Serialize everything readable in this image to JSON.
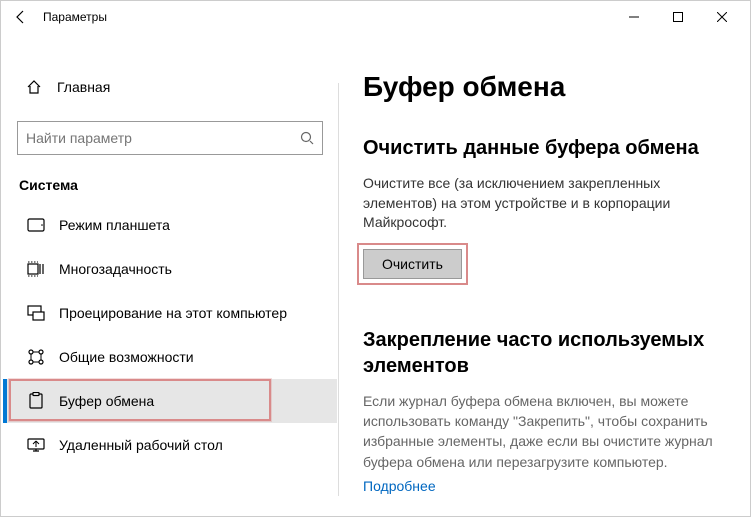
{
  "titlebar": {
    "title": "Параметры"
  },
  "sidebar": {
    "home": "Главная",
    "search_placeholder": "Найти параметр",
    "category": "Система",
    "items": [
      {
        "label": "Режим планшета"
      },
      {
        "label": "Многозадачность"
      },
      {
        "label": "Проецирование на этот компьютер"
      },
      {
        "label": "Общие возможности"
      },
      {
        "label": "Буфер обмена"
      },
      {
        "label": "Удаленный рабочий стол"
      }
    ]
  },
  "main": {
    "title": "Буфер обмена",
    "sec1_title": "Очистить данные буфера обмена",
    "sec1_desc": "Очистите все (за исключением закрепленных элементов) на этом устройстве и в корпорации Майкрософт.",
    "clear_btn": "Очистить",
    "sec2_title": "Закрепление часто используемых элементов",
    "sec2_desc": "Если журнал буфера обмена включен, вы можете использовать команду \"Закрепить\", чтобы сохранить избранные элементы, даже если вы очистите журнал буфера обмена или перезагрузите компьютер.",
    "more_link": "Подробнее"
  }
}
